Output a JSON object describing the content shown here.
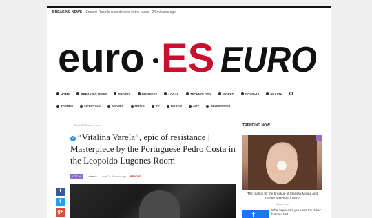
{
  "breaking": {
    "label": "BREAKING NEWS",
    "text": "Encarni Rosello is sentenced in the races - 24 minutes ago"
  },
  "logo": {
    "part1": "euro",
    "part2": "ES",
    "part3": "EURO",
    "colors": {
      "dark": "#111111",
      "red": "#c8102e"
    }
  },
  "nav": {
    "row1": [
      "HOME",
      "BREAKING NEWS",
      "SPORTS",
      "BUSINESS",
      "LOCAL",
      "TECHNOLOGY",
      "WORLD",
      "COVID-19",
      "HEALTH"
    ],
    "row2": [
      "TRENDS",
      "LIFESTYLE",
      "MOVIES",
      "MUSIC",
      "TV",
      "BOOKS",
      "ART",
      "CELEBRITIES"
    ],
    "search_icon": "search-icon"
  },
  "article": {
    "breadcrumb": "Euro ES Euro  ›  Local",
    "title": "“Vitalina Varela”, epic of resistance | Masterpiece by the Portuguese Pedro Costa in the Leopoldo Lugones Room",
    "category_badge": "LOCAL",
    "author": "Lubbers",
    "meta_detail": "Local 2 · 4 hours ago",
    "report": "REPORT"
  },
  "social": {
    "facebook": "f",
    "twitter": "t",
    "googleplus": "g+"
  },
  "sidebar": {
    "heading": "TRENDING NOW",
    "item1_caption": "The reason for the breakup of Clarissa Molina and Vicente Saavedra | USRA",
    "item1_date": "3 days ago",
    "item2_text": "What happens if you press the \"Like\" button a lot?"
  }
}
